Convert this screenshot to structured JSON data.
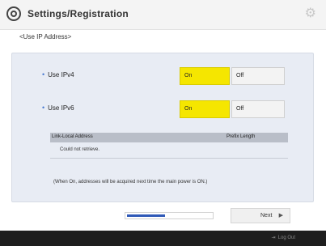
{
  "header": {
    "title": "Settings/Registration",
    "logo_icon": "settings-logo-icon",
    "gear_icon": "gear-icon"
  },
  "subtitle": "<Use IP Address>",
  "ipv4": {
    "label": "Use IPv4",
    "on_label": "On",
    "off_label": "Off",
    "selected": "On"
  },
  "ipv6": {
    "label": "Use IPv6",
    "on_label": "On",
    "off_label": "Off",
    "selected": "On"
  },
  "table": {
    "headers": [
      "Link-Local Address",
      "Prefix Length"
    ],
    "rows": [
      [
        "Could not retrieve.",
        ""
      ]
    ]
  },
  "note": "(When On, addresses will be acquired next time the main power is ON.)",
  "progress": {
    "fraction": 0.45
  },
  "next_label": "Next",
  "footer": {
    "logout_label": "Log Out"
  },
  "colors": {
    "selected_toggle": "#f5e600",
    "progress_fill": "#2f59b7",
    "panel_bg": "#e8ecf4"
  }
}
